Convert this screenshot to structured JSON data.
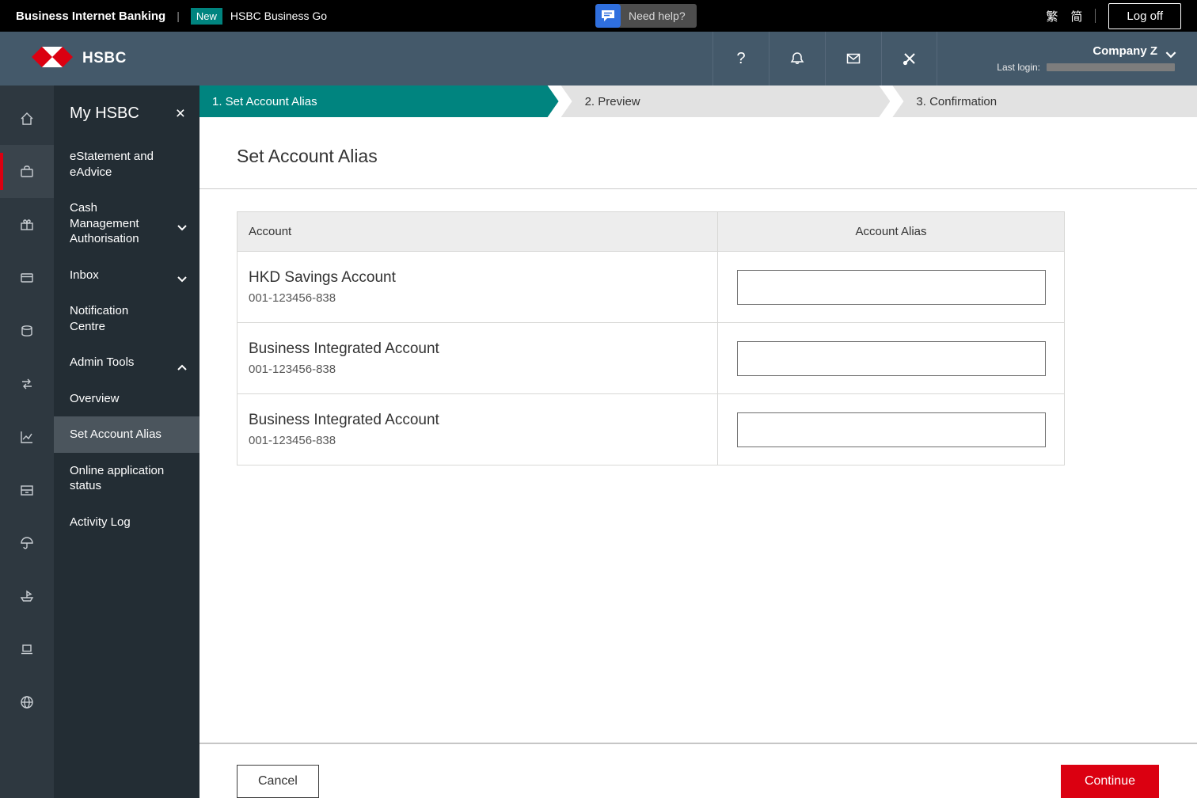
{
  "top_bar": {
    "title": "Business Internet Banking",
    "new_badge": "New",
    "business_go": "HSBC Business Go",
    "need_help": "Need help?",
    "lang_traditional": "繁",
    "lang_simplified": "简",
    "log_off": "Log off"
  },
  "header": {
    "brand": "HSBC",
    "help_glyph": "?",
    "company": "Company Z",
    "last_login_label": "Last login:"
  },
  "rail_icons": [
    "home",
    "accounts",
    "rewards",
    "cards",
    "deposits",
    "transfers",
    "investments",
    "services",
    "insurance",
    "trade",
    "devices",
    "global"
  ],
  "sidebar": {
    "title": "My HSBC",
    "close_glyph": "×",
    "items": [
      {
        "label": "eStatement and eAdvice"
      },
      {
        "label": "Cash Management Authorisation"
      },
      {
        "label": "Inbox"
      },
      {
        "label": "Notification Centre"
      },
      {
        "label": "Admin Tools"
      },
      {
        "label": "Overview"
      },
      {
        "label": "Set Account Alias"
      },
      {
        "label": "Online application status"
      },
      {
        "label": "Activity Log"
      }
    ]
  },
  "steps": [
    {
      "label": "1. Set Account Alias"
    },
    {
      "label": "2. Preview"
    },
    {
      "label": "3. Confirmation"
    }
  ],
  "page": {
    "title": "Set Account Alias"
  },
  "table": {
    "headers": [
      "Account",
      "Account Alias"
    ],
    "rows": [
      {
        "name": "HKD Savings Account",
        "number": "001-123456-838",
        "alias": ""
      },
      {
        "name": "Business Integrated Account",
        "number": "001-123456-838",
        "alias": ""
      },
      {
        "name": "Business Integrated Account",
        "number": "001-123456-838",
        "alias": ""
      }
    ]
  },
  "actions": {
    "cancel": "Cancel",
    "continue": "Continue"
  },
  "colors": {
    "brand_red": "#db0011",
    "teal": "#00847f",
    "header_slate": "#44596a"
  }
}
